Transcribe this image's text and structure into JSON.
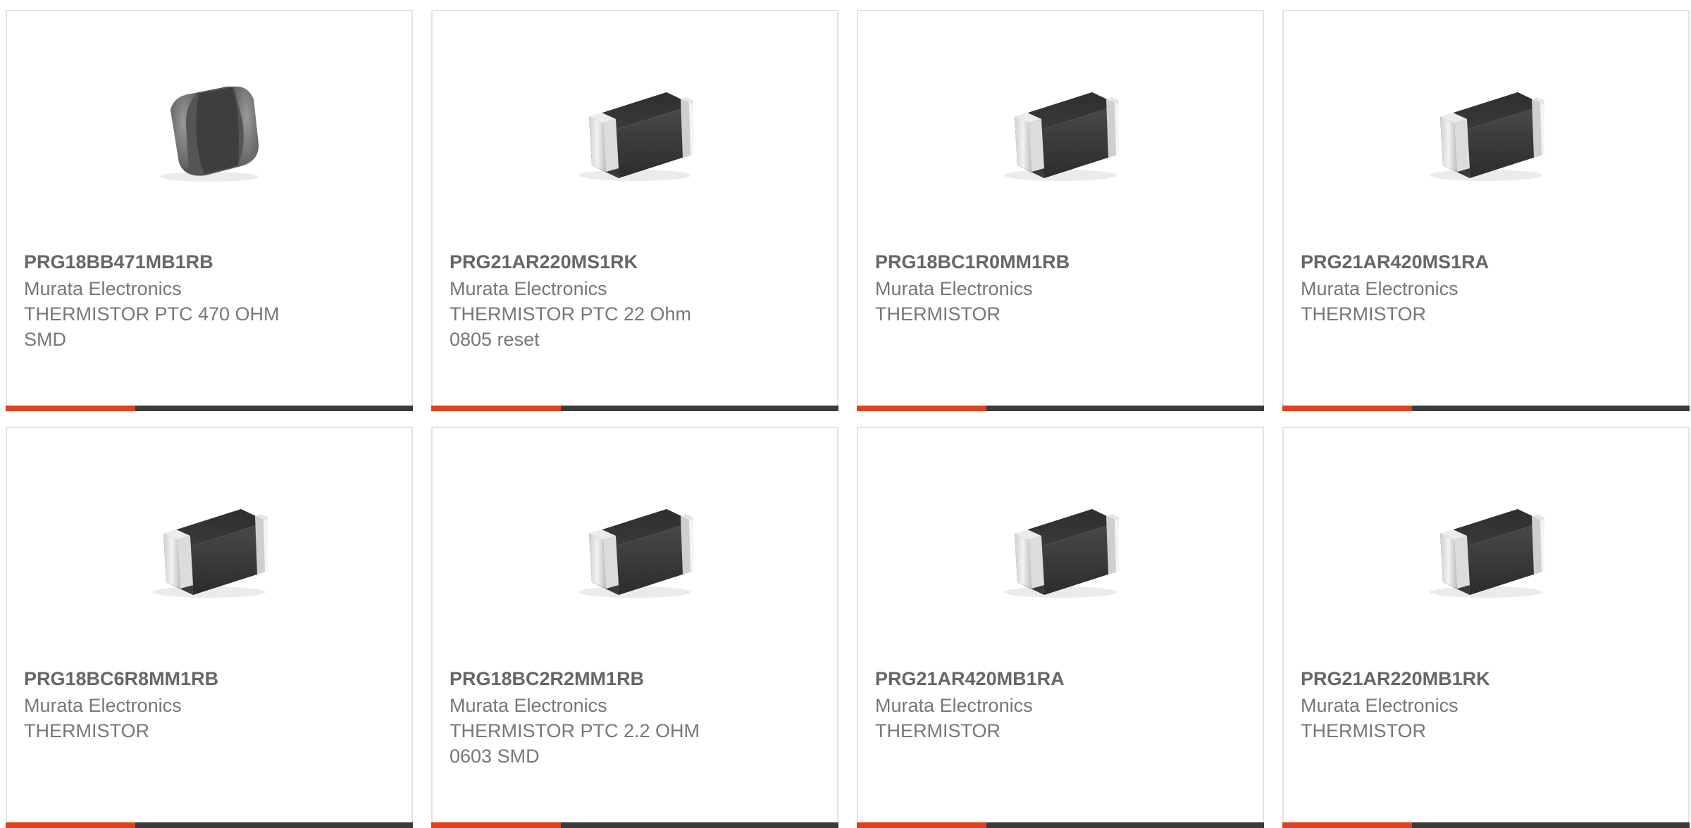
{
  "products": [
    {
      "part_number": "PRG18BB471MB1RB",
      "manufacturer": "Murata Electronics",
      "description": "THERMISTOR PTC 470 OHM SMD",
      "image": "smd-chip-round-icon"
    },
    {
      "part_number": "PRG21AR220MS1RK",
      "manufacturer": "Murata Electronics",
      "description": "THERMISTOR PTC 22 Ohm 0805 reset",
      "image": "smd-chip-icon"
    },
    {
      "part_number": "PRG18BC1R0MM1RB",
      "manufacturer": "Murata Electronics",
      "description": "THERMISTOR",
      "image": "smd-chip-icon"
    },
    {
      "part_number": "PRG21AR420MS1RA",
      "manufacturer": "Murata Electronics",
      "description": "THERMISTOR",
      "image": "smd-chip-icon"
    },
    {
      "part_number": "PRG18BC6R8MM1RB",
      "manufacturer": "Murata Electronics",
      "description": "THERMISTOR",
      "image": "smd-chip-icon"
    },
    {
      "part_number": "PRG18BC2R2MM1RB",
      "manufacturer": "Murata Electronics",
      "description": "THERMISTOR PTC 2.2 OHM 0603 SMD",
      "image": "smd-chip-icon"
    },
    {
      "part_number": "PRG21AR420MB1RA",
      "manufacturer": "Murata Electronics",
      "description": "THERMISTOR",
      "image": "smd-chip-icon"
    },
    {
      "part_number": "PRG21AR220MB1RK",
      "manufacturer": "Murata Electronics",
      "description": "THERMISTOR",
      "image": "smd-chip-icon"
    }
  ],
  "colors": {
    "accent": "#e0401c",
    "bar": "#3b3b3b",
    "border": "#e3e3e3",
    "text": "#777777"
  }
}
